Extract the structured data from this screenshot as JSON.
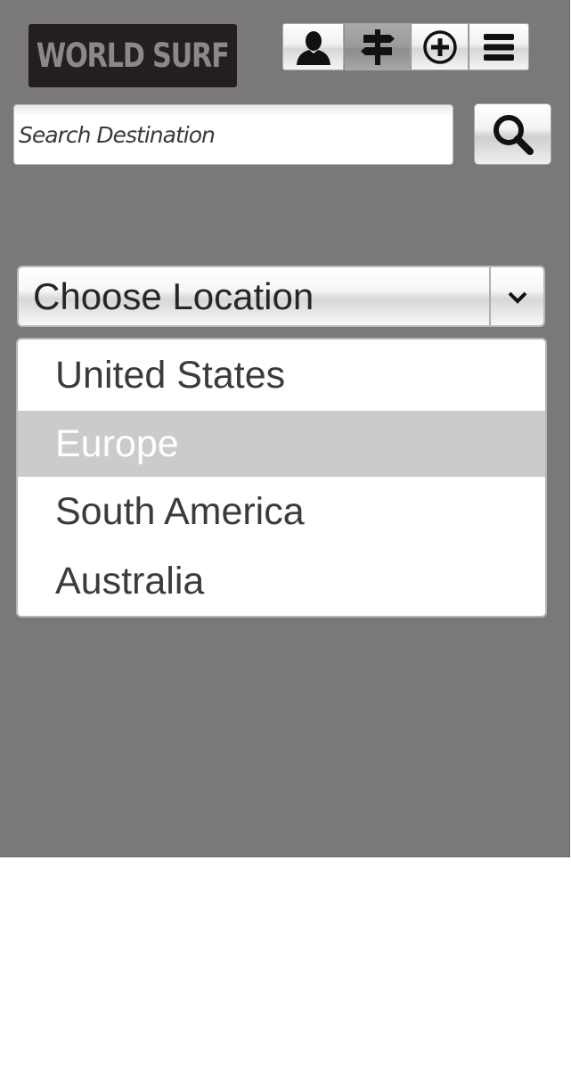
{
  "header": {
    "logo_text": "WORLD SURF",
    "nav": [
      {
        "icon": "user-icon",
        "active": false
      },
      {
        "icon": "signpost-icon",
        "active": true
      },
      {
        "icon": "add-circle-icon",
        "active": false
      },
      {
        "icon": "menu-icon",
        "active": false
      }
    ]
  },
  "search": {
    "placeholder": "Search Destination",
    "value": ""
  },
  "location_select": {
    "label": "Choose Location",
    "options": [
      "United States",
      "Europe",
      "South America",
      "Australia"
    ],
    "highlighted": "Europe"
  },
  "colors": {
    "background": "#7a7978",
    "logo_bg": "#231f1f",
    "highlight": "#cbcbcb"
  }
}
